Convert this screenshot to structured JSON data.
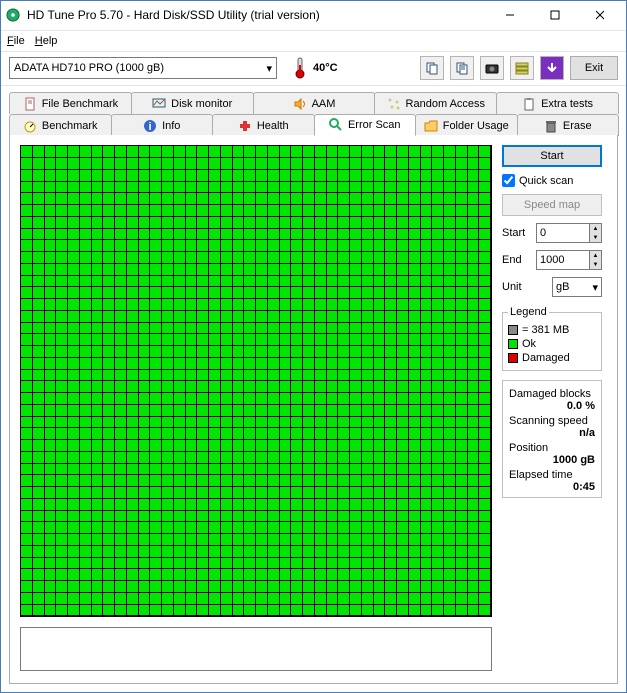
{
  "window": {
    "title": "HD Tune Pro 5.70 - Hard Disk/SSD Utility (trial version)"
  },
  "menu": {
    "file": "File",
    "help": "Help"
  },
  "toolbar": {
    "drive": "ADATA   HD710 PRO (1000 gB)",
    "temperature": "40°C",
    "exit": "Exit"
  },
  "tabs_top": [
    {
      "label": "File Benchmark"
    },
    {
      "label": "Disk monitor"
    },
    {
      "label": "AAM"
    },
    {
      "label": "Random Access"
    },
    {
      "label": "Extra tests"
    }
  ],
  "tabs_bottom": [
    {
      "label": "Benchmark"
    },
    {
      "label": "Info"
    },
    {
      "label": "Health"
    },
    {
      "label": "Error Scan"
    },
    {
      "label": "Folder Usage"
    },
    {
      "label": "Erase"
    }
  ],
  "side": {
    "start_btn": "Start",
    "quick_scan": "Quick scan",
    "speed_map": "Speed map",
    "start_lbl": "Start",
    "start_val": "0",
    "end_lbl": "End",
    "end_val": "1000",
    "unit_lbl": "Unit",
    "unit_val": "gB",
    "legend_title": "Legend",
    "block_size": "= 381 MB",
    "ok": "Ok",
    "damaged": "Damaged"
  },
  "stats": {
    "damaged_lbl": "Damaged blocks",
    "damaged_val": "0.0 %",
    "speed_lbl": "Scanning speed",
    "speed_val": "n/a",
    "pos_lbl": "Position",
    "pos_val": "1000 gB",
    "elapsed_lbl": "Elapsed time",
    "elapsed_val": "0:45"
  }
}
